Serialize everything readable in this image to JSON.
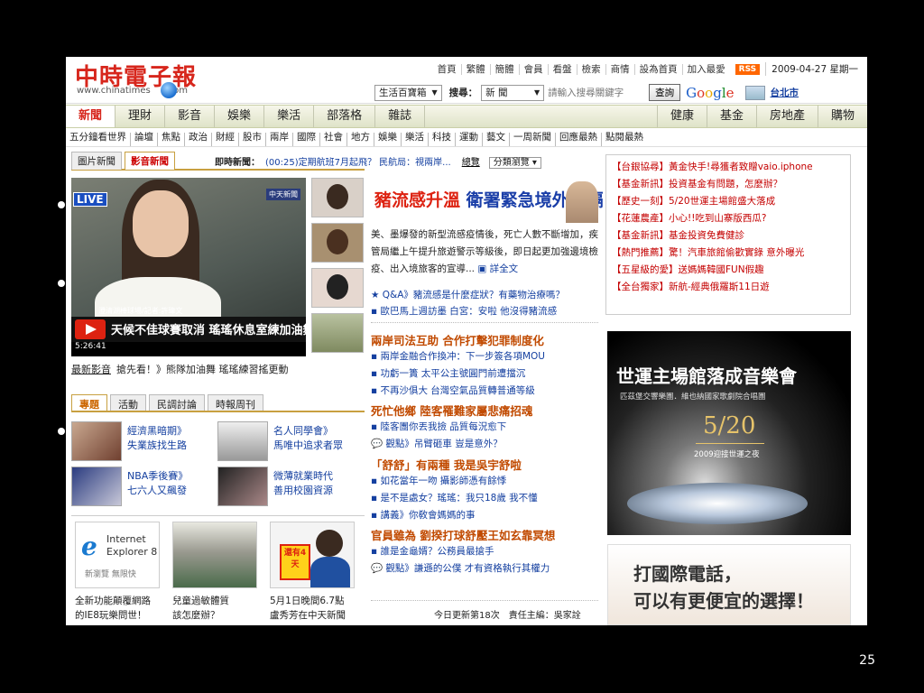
{
  "slide": {
    "number": "25"
  },
  "header": {
    "logo": "中時電子報",
    "logo_url": "www.chinatimes",
    "logo_url_tail": "com",
    "toplinks": [
      "首頁",
      "繁體",
      "簡體",
      "會員",
      "看盤",
      "檢索",
      "商情",
      "設為首頁",
      "加入最愛"
    ],
    "rss": "RSS",
    "date": "2009-04-27 星期一",
    "shop_select": "生活百寶箱",
    "search_label": "搜尋：",
    "search_scope": "新 聞",
    "search_placeholder": "請輸入搜尋關鍵字",
    "search_button": "查詢",
    "google": [
      "G",
      "o",
      "o",
      "g",
      "l",
      "e"
    ],
    "city": "台北市"
  },
  "nav": {
    "tabs": [
      "新聞",
      "理財",
      "影音",
      "娛樂",
      "樂活",
      "部落格",
      "雜誌"
    ],
    "right_tabs": [
      "健康",
      "基金",
      "房地產",
      "購物"
    ]
  },
  "subnav": [
    "五分鐘看世界",
    "論壇",
    "焦點",
    "政治",
    "財經",
    "股市",
    "兩岸",
    "國際",
    "社會",
    "地方",
    "娛樂",
    "樂活",
    "科技",
    "運動",
    "藝文",
    "一周新聞",
    "回應最熱",
    "點閱最熱"
  ],
  "video": {
    "tabs": [
      "圖片新聞",
      "影音新聞"
    ],
    "breaking_label": "即時新聞：",
    "breaking_text": "(00:25)定期航班7月起飛？ 民航局：視兩岸...",
    "overview": "總覽",
    "category": "分類瀏覽",
    "live": "LIVE",
    "channel": "中天新聞",
    "reporter": "澄清湖棒球場/記者:許瑋文",
    "caption": "天候不佳球賽取消 瑤瑤休息室練加油舞",
    "time": "5:26:41",
    "latest_label": "最新影音",
    "latest_text": "搶先看！》熊隊加油舞 瑤瑤練習搖更動"
  },
  "topics": {
    "tabs": [
      "專題",
      "活動",
      "民調討論",
      "時報周刊"
    ],
    "items": [
      {
        "l1": "經濟黑暗期》",
        "l2": "失業族找生路"
      },
      {
        "l1": "名人同學會》",
        "l2": "馬唯中追求者眾"
      },
      {
        "l1": "NBA季後賽》",
        "l2": "七六人又飆發"
      },
      {
        "l1": "微薄就業時代",
        "l2": "善用校園資源"
      }
    ],
    "ie_brand1": "Internet",
    "ie_brand2": "Explorer 8",
    "ie_slogan": "新瀏覽 無限快",
    "badge": "還有4天",
    "promos": [
      {
        "l1": "全新功能顛覆網路",
        "l2": "的IE8玩樂問世！"
      },
      {
        "l1": "兒童過敏體質",
        "l2": "該怎麼辦？"
      },
      {
        "l1": "5月1日晚間6.7點",
        "l2": "盧秀芳在中天新聞"
      }
    ]
  },
  "news": {
    "headline_a": "豬流感升溫",
    "headline_b": "衛署緊急境外阻隔",
    "lead": "美、墨爆發的新型流感疫情後，死亡人數不斷增加，疾管局繼上午提升旅遊警示等級後，即日起更加強邊境檢疫、出入境旅客的宣導...",
    "lead_more": "詳全文",
    "q1": "★ Q&A》豬流感是什麼症狀？有藥物治療嗎？",
    "q2": "▪ 歐巴馬上週訪墨 白宮：安啦 他沒得豬流感",
    "h2": "兩岸司法互助 合作打擊犯罪制度化",
    "h2_items": [
      "▪ 兩岸金融合作換冲：下一步簽各項MOU",
      "▪ 功虧一簣 太平公主號圓門前遭擋沉",
      "▪ 不再沙俱大 台灣空氣品質轉普通等級"
    ],
    "h3": "死忙他鄉 陸客罹難家屬悲痛招魂",
    "h3_items": [
      "▪ 陸客團你丟我撿 品質每況愈下",
      "觀點》吊臂砸車 豈是意外？"
    ],
    "h4": "「舒舒」有兩種 我是吳宇舒啦",
    "h4_items": [
      "▪ 如花當年一吻 攝影師憑有餘悸",
      "▪ 是不是處女？瑤瑤：我只18歲 我不懂",
      "▪ 講義》你敎會媽媽的事"
    ],
    "h5": "官員雖為 劉揆打球舒壓王如玄靠冥想",
    "h5_items": [
      "▪ 誰是金龜婿？公務員最搶手",
      "觀點》謙遜的公僕 才有資格執行其權力"
    ],
    "updated": "今日更新第18次　責任主編：吳家詮"
  },
  "sidebar": {
    "links": [
      "【台銀協尋】黃金快手!尋獲者致贈vaio.iphone",
      "【基金新訊】投資基金有問題，怎麼辦？",
      "【歷史一刻】5/20世運主場館盛大落成",
      "【花蓮農產】小心!!吃到山寨版西瓜?",
      "【基金新訊】基金投資免費健診",
      "【熱門推薦】驚！汽車旅館偷歡實錄 意外曝光",
      "【五星級的愛】送媽媽韓國FUN假趣",
      "【全台獨家】新航-經典俄羅斯11日遊"
    ],
    "banner_title": "世運主場館落成音樂會",
    "banner_sub": "匹茲堡交響樂團．維也納國家歌劇院合唱團",
    "banner_date": "5/20",
    "banner_caption": "2009迎接世運之夜",
    "ad_line1": "打國際電話，",
    "ad_line2": "可以有更便宜的選擇！"
  }
}
